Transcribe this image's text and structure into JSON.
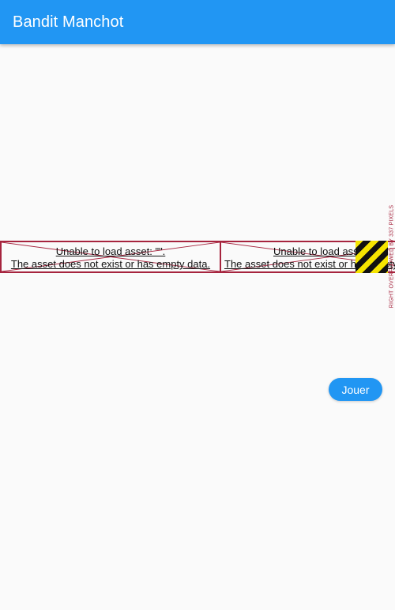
{
  "appbar": {
    "title": "Bandit Manchot"
  },
  "asset_errors": [
    {
      "line1": "Unable to load asset: \"\".",
      "line2": "The asset does not exist or has empty data."
    },
    {
      "line1": "Unable to load asset: \"\".",
      "line2": "The asset does not exist or has empty data."
    }
  ],
  "overflow_warning": "RIGHT OVERFLOWED BY 337 PIXELS",
  "play_button": {
    "label": "Jouer"
  },
  "colors": {
    "primary": "#2196f3",
    "error_border": "#a6243e",
    "hazard_yellow": "#f5e400",
    "background": "#fafafa"
  }
}
